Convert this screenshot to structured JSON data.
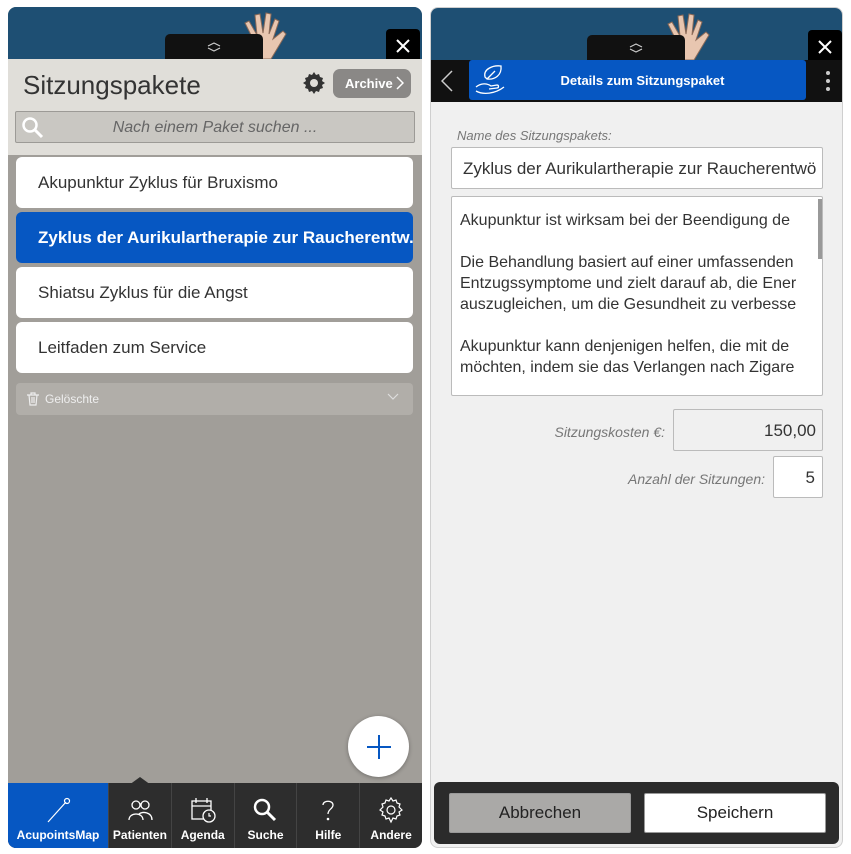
{
  "left": {
    "title": "Sitzungspakete",
    "archive_label": "Archive",
    "search_placeholder": "Nach einem Paket suchen ...",
    "items": [
      {
        "label": "Akupunktur Zyklus für Bruxismo"
      },
      {
        "label": "Zyklus der Aurikulartherapie zur Raucherentw..."
      },
      {
        "label": "Shiatsu Zyklus für die Angst"
      },
      {
        "label": "Leitfaden zum Service"
      }
    ],
    "deleted_label": "Gelöschte",
    "tabs": [
      {
        "label": "AcupointsMap",
        "icon": "needle-icon"
      },
      {
        "label": "Patienten",
        "icon": "patients-icon"
      },
      {
        "label": "Agenda",
        "icon": "calendar-icon"
      },
      {
        "label": "Suche",
        "icon": "search-icon"
      },
      {
        "label": "Hilfe",
        "icon": "help-icon"
      },
      {
        "label": "Andere",
        "icon": "gear-icon"
      }
    ]
  },
  "right": {
    "title": "Details zum Sitzungspaket",
    "name_label": "Name des Sitzungspakets:",
    "name_value": "Zyklus der Aurikulartherapie zur Raucherentwö",
    "description": [
      "Akupunktur ist wirksam bei der Beendigung de",
      "Die Behandlung basiert auf einer umfassenden|Entzugssymptome und zielt darauf ab, die Ener|auszugleichen, um die Gesundheit zu verbesse",
      "Akupunktur kann denjenigen helfen, die mit de|möchten, indem sie das Verlangen nach Zigare"
    ],
    "cost_label": "Sitzungskosten €:",
    "cost_value": "150,00",
    "count_label": "Anzahl der Sitzungen:",
    "count_value": "5",
    "cancel_label": "Abbrechen",
    "save_label": "Speichern"
  },
  "colors": {
    "accent": "#0657c2",
    "banner": "#1e4f73",
    "tabbar": "#2d2d2d"
  }
}
